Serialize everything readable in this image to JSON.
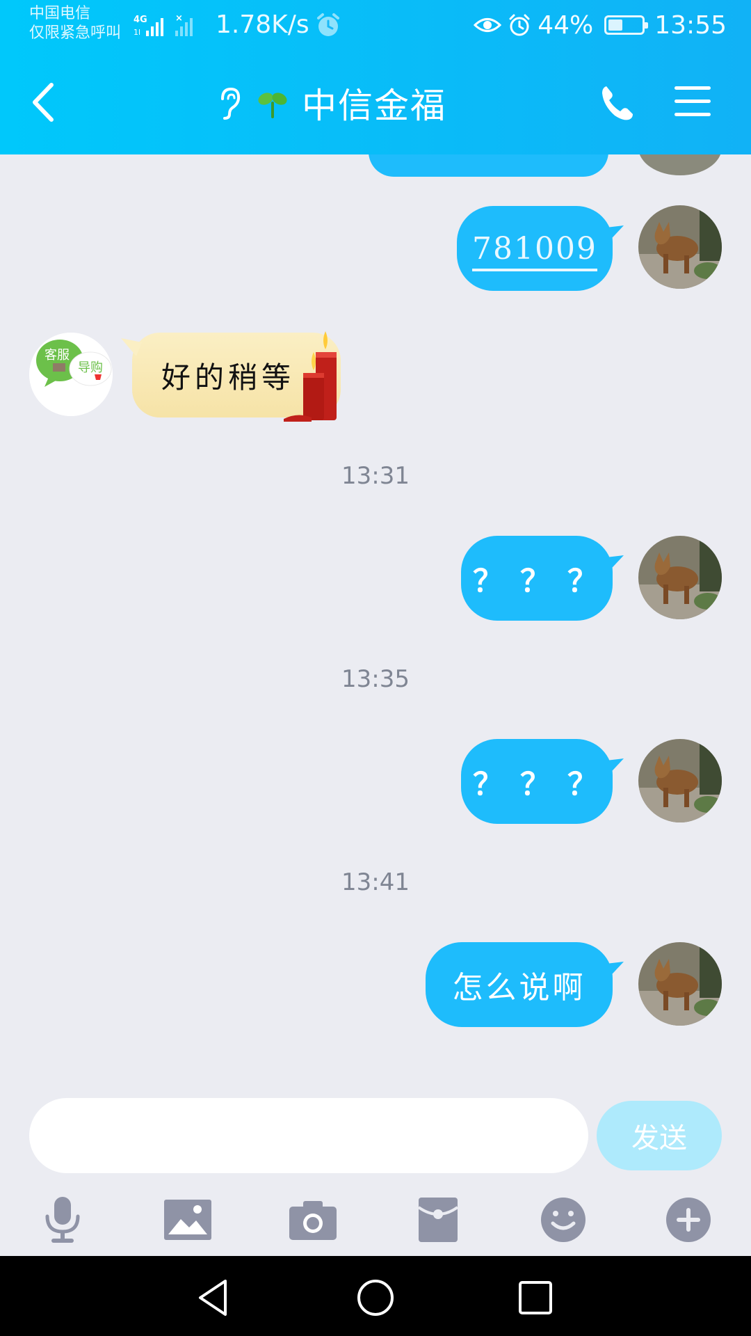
{
  "status_bar": {
    "carrier_line1": "中国电信",
    "carrier_line2": "仅限紧急呼叫",
    "network_label": "4G",
    "speed": "1.78K/s",
    "battery_percent": "44%",
    "battery_level": 0.44,
    "time": "13:55"
  },
  "header": {
    "title": "中信金福",
    "icons": [
      "back-icon",
      "ear-icon",
      "sprout-icon",
      "phone-icon",
      "menu-icon"
    ]
  },
  "messages": [
    {
      "side": "right",
      "type": "link",
      "text": "781009"
    },
    {
      "side": "left",
      "type": "sticker-bubble",
      "text": "好的稍等"
    },
    {
      "side": "center",
      "type": "time",
      "text": "13:31"
    },
    {
      "side": "right",
      "type": "text",
      "text": "？？？"
    },
    {
      "side": "center",
      "type": "time",
      "text": "13:35"
    },
    {
      "side": "right",
      "type": "text",
      "text": "？？？"
    },
    {
      "side": "center",
      "type": "time",
      "text": "13:41"
    },
    {
      "side": "right",
      "type": "text",
      "text": "怎么说啊"
    }
  ],
  "agent_avatar": {
    "label1": "客服",
    "label2": "导购"
  },
  "composer": {
    "input_value": "",
    "send_label": "发送"
  },
  "toolbar_icons": [
    "microphone-icon",
    "image-icon",
    "camera-icon",
    "red-packet-icon",
    "emoji-icon",
    "plus-icon"
  ],
  "colors": {
    "header_start": "#00c8fb",
    "header_end": "#11b2f6",
    "bubble_blue": "#1ebcfc",
    "chat_bg": "#ebecf2",
    "send_disabled": "#aeeafc",
    "tool_gray": "#8f93a6"
  }
}
